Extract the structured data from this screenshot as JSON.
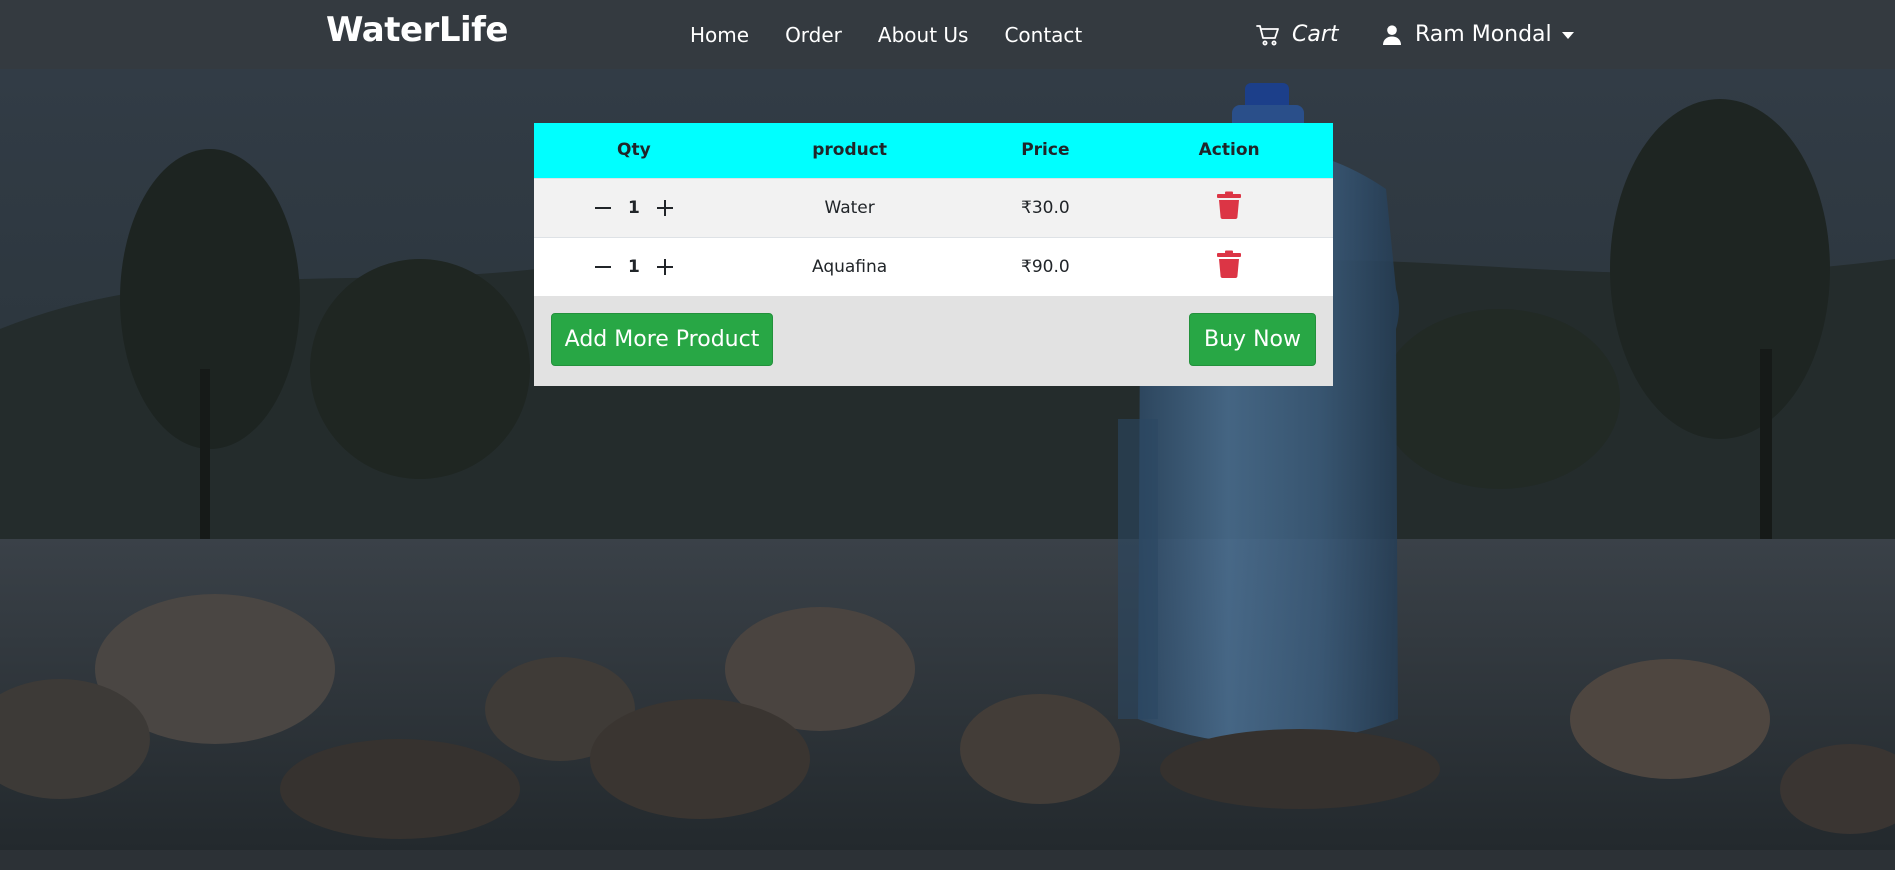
{
  "navbar": {
    "brand": "WaterLife",
    "links": [
      "Home",
      "Order",
      "About Us",
      "Contact"
    ],
    "cart_label": "Cart",
    "user_name": "Ram Mondal"
  },
  "cart": {
    "headers": [
      "Qty",
      "product",
      "Price",
      "Action"
    ],
    "rows": [
      {
        "qty": "1",
        "product": "Water",
        "price": "₹30.0"
      },
      {
        "qty": "1",
        "product": "Aquafina",
        "price": "₹90.0"
      }
    ],
    "add_more_label": "Add More Product",
    "buy_now_label": "Buy Now"
  },
  "colors": {
    "navbar_bg": "#343a40",
    "table_header_bg": "#00ffff",
    "button_green": "#28a745",
    "delete_red": "#dc3545"
  },
  "icons": {
    "cart": "cart-icon",
    "user": "user-icon",
    "minus": "minus-icon",
    "plus": "plus-icon",
    "delete": "trash-icon"
  }
}
